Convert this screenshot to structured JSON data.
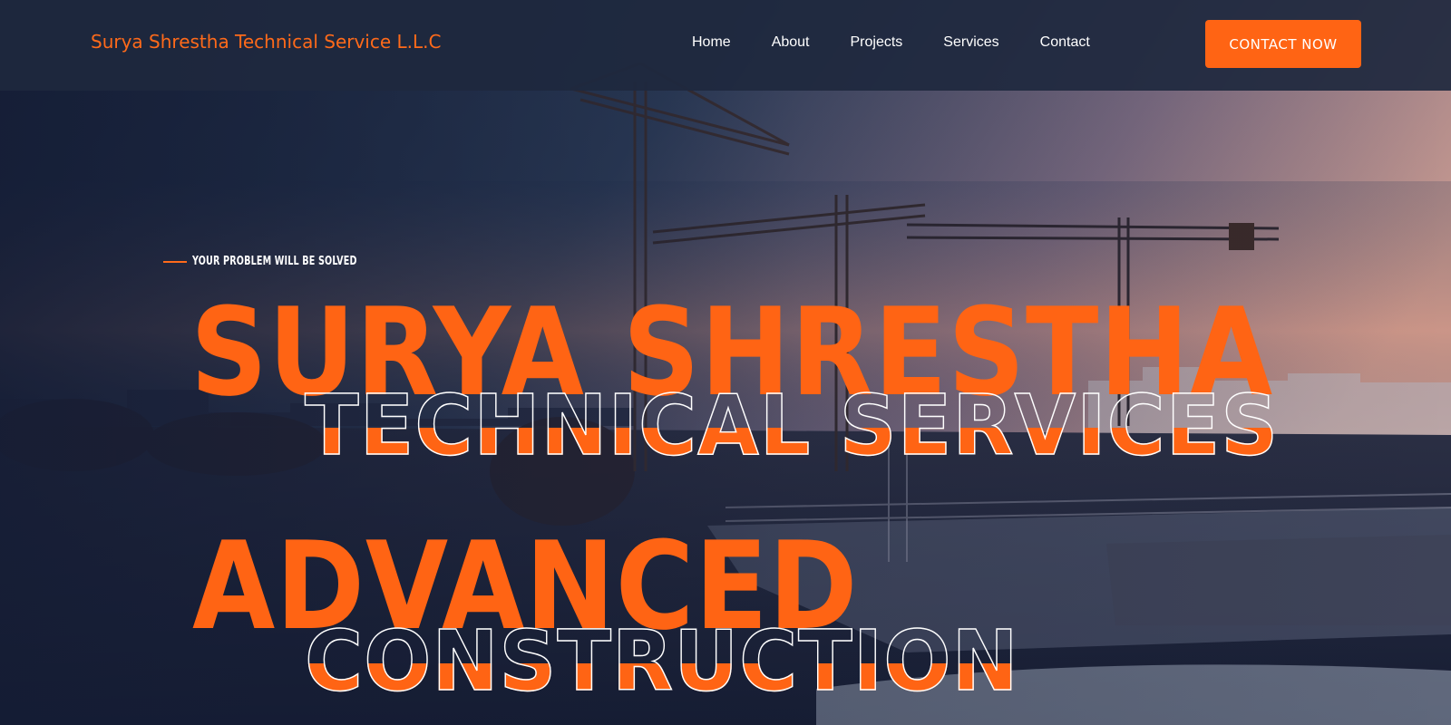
{
  "header": {
    "brand": "Surya Shrestha Technical Service L.L.C",
    "nav": [
      "Home",
      "About",
      "Projects",
      "Services",
      "Contact"
    ],
    "cta_label": "CONTACT NOW"
  },
  "hero": {
    "tagline": "YOUR PROBLEM WILL BE SOLVED",
    "headline_1": "SURYA SHRESTHA",
    "headline_2": "TECHNICAL SERVICES",
    "headline_3": "ADVANCED",
    "headline_4": "CONSTRUCTION",
    "background": "construction-site-cranes-dusk-image"
  },
  "colors": {
    "accent": "#ff6414",
    "header_bg": "#1e283e",
    "text_light": "#ffffff"
  }
}
